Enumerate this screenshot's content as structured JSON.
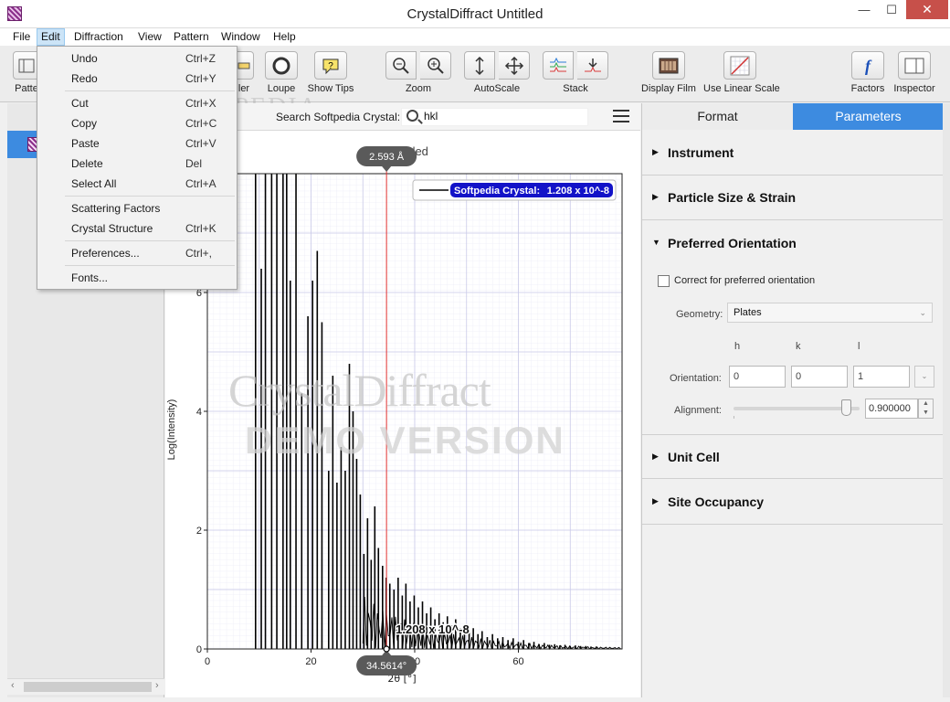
{
  "window": {
    "title": "CrystalDiffract Untitled",
    "min": "—",
    "max": "☐",
    "close": "✕"
  },
  "menu": [
    "File",
    "Edit",
    "Diffraction",
    "View",
    "Pattern",
    "Window",
    "Help"
  ],
  "toolbar": {
    "patterns": "Patte",
    "ruler": "ler",
    "loupe": "Loupe",
    "show_tips": "Show Tips",
    "zoom": "Zoom",
    "autoscale": "AutoScale",
    "stack": "Stack",
    "display_film": "Display Film",
    "linear_scale": "Use Linear Scale",
    "factors": "Factors",
    "inspector": "Inspector"
  },
  "edit_menu": {
    "undo": {
      "label": "Undo",
      "shortcut": "Ctrl+Z"
    },
    "redo": {
      "label": "Redo",
      "shortcut": "Ctrl+Y"
    },
    "cut": {
      "label": "Cut",
      "shortcut": "Ctrl+X"
    },
    "copy": {
      "label": "Copy",
      "shortcut": "Ctrl+C"
    },
    "paste": {
      "label": "Paste",
      "shortcut": "Ctrl+V"
    },
    "delete": {
      "label": "Delete",
      "shortcut": "Del"
    },
    "select_all": {
      "label": "Select All",
      "shortcut": "Ctrl+A"
    },
    "scattering": {
      "label": "Scattering Factors",
      "shortcut": ""
    },
    "structure": {
      "label": "Crystal Structure",
      "shortcut": "Ctrl+K"
    },
    "preferences": {
      "label": "Preferences...",
      "shortcut": "Ctrl+,"
    },
    "fonts": {
      "label": "Fonts...",
      "shortcut": ""
    }
  },
  "search": {
    "label": "Search Softpedia Crystal:",
    "value": "hkl"
  },
  "watermark": {
    "line1": "CrystalDiffract",
    "line2": "DEMO VERSION",
    "softpedia": "SOFTPEDIA"
  },
  "chart_data": {
    "type": "line",
    "title": "Untitled",
    "title_visible": "itled",
    "xlabel": "2θ [°]",
    "ylabel": "Log(Intensity)",
    "xlim": [
      0,
      80
    ],
    "ylim": [
      0,
      8
    ],
    "x_ticks": [
      "0",
      "20",
      "40",
      "60"
    ],
    "y_ticks": [
      "0",
      "2",
      "4",
      "6"
    ],
    "grid": true,
    "legend": {
      "position": "top-right",
      "entries": [
        {
          "name": "Softpedia Crystal:",
          "value": "1.208 x 10^-8"
        }
      ]
    },
    "cursor": {
      "x": 34.5614,
      "x_label": "34.5614°",
      "d_label": "2.593 Å",
      "y_label": "1.208 x 10^-8"
    },
    "peaks": [
      [
        9.3,
        8
      ],
      [
        10.4,
        6.4
      ],
      [
        11.2,
        8
      ],
      [
        12.4,
        8
      ],
      [
        13.4,
        8
      ],
      [
        14.6,
        8
      ],
      [
        15.3,
        8
      ],
      [
        16.0,
        6.2
      ],
      [
        17.1,
        8
      ],
      [
        18.2,
        4.3
      ],
      [
        19.4,
        5.6
      ],
      [
        20.3,
        6.2
      ],
      [
        21.2,
        6.7
      ],
      [
        22.1,
        5.5
      ],
      [
        23.4,
        3.0
      ],
      [
        24.2,
        4.6
      ],
      [
        25.0,
        2.8
      ],
      [
        25.8,
        3.4
      ],
      [
        26.6,
        3.0
      ],
      [
        27.4,
        4.8
      ],
      [
        28.1,
        4.0
      ],
      [
        28.8,
        3.2
      ],
      [
        29.5,
        2.6
      ],
      [
        30.2,
        1.6
      ],
      [
        30.9,
        2.2
      ],
      [
        31.6,
        1.5
      ],
      [
        32.3,
        2.4
      ],
      [
        33.0,
        1.7
      ],
      [
        33.8,
        1.4
      ],
      [
        34.5,
        1.2
      ],
      [
        35.2,
        1.1
      ],
      [
        36.0,
        1.0
      ],
      [
        36.8,
        1.2
      ],
      [
        37.6,
        0.9
      ],
      [
        38.3,
        1.1
      ],
      [
        39.1,
        0.8
      ],
      [
        39.9,
        0.9
      ],
      [
        40.7,
        0.7
      ],
      [
        41.5,
        0.8
      ],
      [
        42.3,
        0.6
      ],
      [
        43.1,
        0.7
      ],
      [
        43.9,
        0.5
      ],
      [
        44.7,
        0.6
      ],
      [
        45.5,
        0.45
      ],
      [
        46.3,
        0.55
      ],
      [
        47.1,
        0.4
      ],
      [
        47.9,
        0.5
      ],
      [
        48.8,
        0.35
      ],
      [
        49.6,
        0.4
      ],
      [
        50.5,
        0.3
      ],
      [
        51.3,
        0.35
      ],
      [
        52.2,
        0.25
      ],
      [
        53.0,
        0.3
      ],
      [
        54.0,
        0.2
      ],
      [
        55.0,
        0.25
      ],
      [
        56.0,
        0.18
      ],
      [
        57.0,
        0.2
      ],
      [
        58.0,
        0.15
      ],
      [
        59.0,
        0.18
      ],
      [
        60.0,
        0.12
      ],
      [
        61.0,
        0.15
      ],
      [
        62.0,
        0.1
      ],
      [
        63.0,
        0.12
      ],
      [
        64.0,
        0.08
      ],
      [
        65.0,
        0.1
      ],
      [
        66.0,
        0.07
      ],
      [
        67.0,
        0.08
      ],
      [
        68.0,
        0.06
      ],
      [
        69.0,
        0.07
      ],
      [
        70.0,
        0.05
      ],
      [
        71.0,
        0.06
      ],
      [
        72.0,
        0.05
      ],
      [
        73.0,
        0.05
      ],
      [
        74.0,
        0.04
      ],
      [
        75.0,
        0.04
      ]
    ]
  },
  "panel": {
    "tab_format": "Format",
    "tab_parameters": "Parameters",
    "instrument": "Instrument",
    "particle": "Particle Size & Strain",
    "preferred": "Preferred Orientation",
    "correct_label": "Correct for preferred orientation",
    "geometry_label": "Geometry:",
    "geometry_value": "Plates",
    "h": "h",
    "k": "k",
    "l": "l",
    "orientation_label": "Orientation:",
    "orient_h": "0",
    "orient_k": "0",
    "orient_l": "1",
    "alignment_label": "Alignment:",
    "alignment_value": 0.9,
    "alignment_text": "0.900000",
    "unit_cell": "Unit Cell",
    "site_occupancy": "Site Occupancy"
  }
}
